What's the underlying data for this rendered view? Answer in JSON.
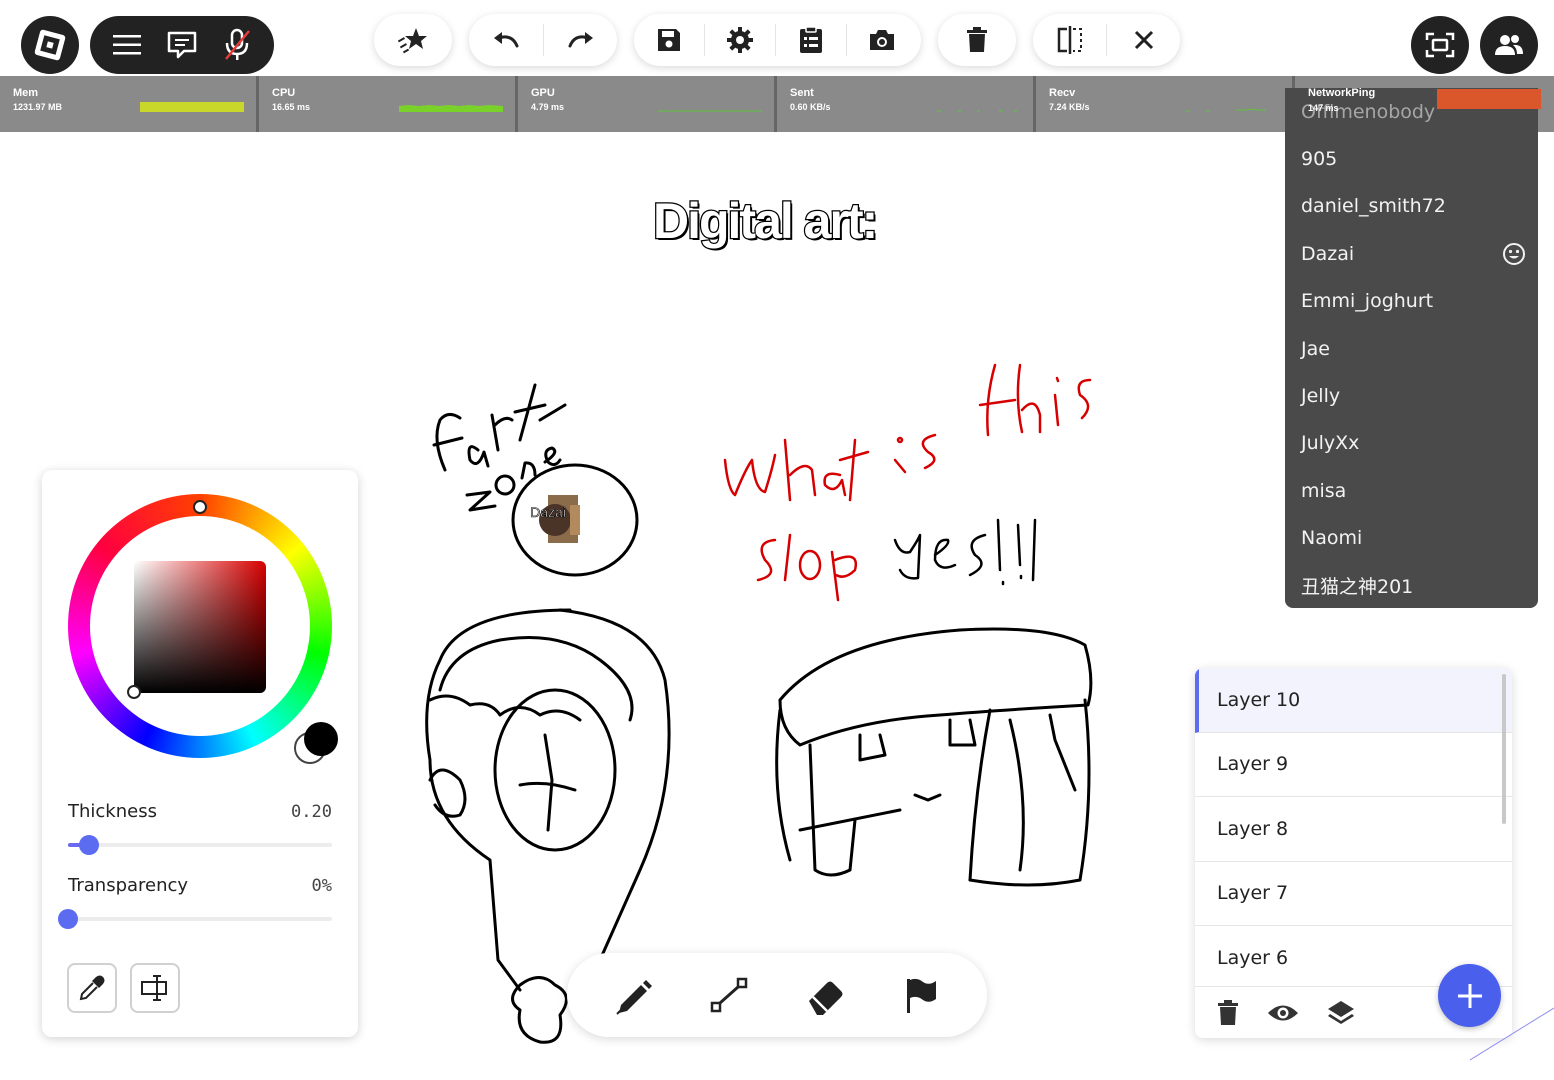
{
  "top_left": {
    "roblox_logo": "roblox-logo",
    "menu_icon": "hamburger-icon",
    "chat_icon": "chat-icon",
    "mic_icon": "mic-muted-icon"
  },
  "toolbar": {
    "groups": [
      [
        "favorite-icon"
      ],
      [
        "undo-icon",
        "redo-icon"
      ],
      [
        "save-icon",
        "settings-icon",
        "clipboard-icon",
        "camera-icon"
      ],
      [
        "trash-icon"
      ],
      [
        "mirror-icon",
        "close-icon"
      ]
    ]
  },
  "top_right": {
    "screenshot_icon": "screen-capture-icon",
    "friends_icon": "people-icon"
  },
  "stats": [
    {
      "name": "Mem",
      "value": "1231.97 MB",
      "graph_color": "#c9d72a"
    },
    {
      "name": "CPU",
      "value": "16.65 ms",
      "graph_color": "#7ad12a"
    },
    {
      "name": "GPU",
      "value": "4.79 ms",
      "graph_color": "#5ec43b"
    },
    {
      "name": "Sent",
      "value": "0.60 KB/s",
      "graph_color": "#5ec43b"
    },
    {
      "name": "Recv",
      "value": "7.24 KB/s",
      "graph_color": "#5ec43b"
    }
  ],
  "network_ping": {
    "name": "NetworkPing",
    "value": "147 ms",
    "bar_color": "#d9572b"
  },
  "players": [
    "Offimenobody",
    "905",
    "daniel_smith72",
    "Dazai",
    "Emmi_joghurt",
    "Jae",
    "Jelly",
    "JulyXx",
    "misa",
    "Naomi",
    "丑猫之神201"
  ],
  "canvas": {
    "title": "Digital art:",
    "avatar_name": "Dazai"
  },
  "color_panel": {
    "selected_color": "#000000",
    "hue_color": "#d80000",
    "thickness_label": "Thickness",
    "thickness_value": "0.20",
    "thickness_fraction": 0.08,
    "transparency_label": "Transparency",
    "transparency_value": "0%",
    "transparency_fraction": 0.0,
    "tools": [
      "eyedropper-icon",
      "text-tool-icon"
    ]
  },
  "bottom_tools": [
    "pencil-icon",
    "line-tool-icon",
    "eraser-icon",
    "flag-icon"
  ],
  "layers": {
    "items": [
      "Layer 10",
      "Layer 9",
      "Layer 8",
      "Layer 7",
      "Layer 6"
    ],
    "active": "Layer 10",
    "actions": [
      "delete-layer-icon",
      "visibility-icon",
      "layers-icon"
    ],
    "add_icon": "plus-icon"
  }
}
